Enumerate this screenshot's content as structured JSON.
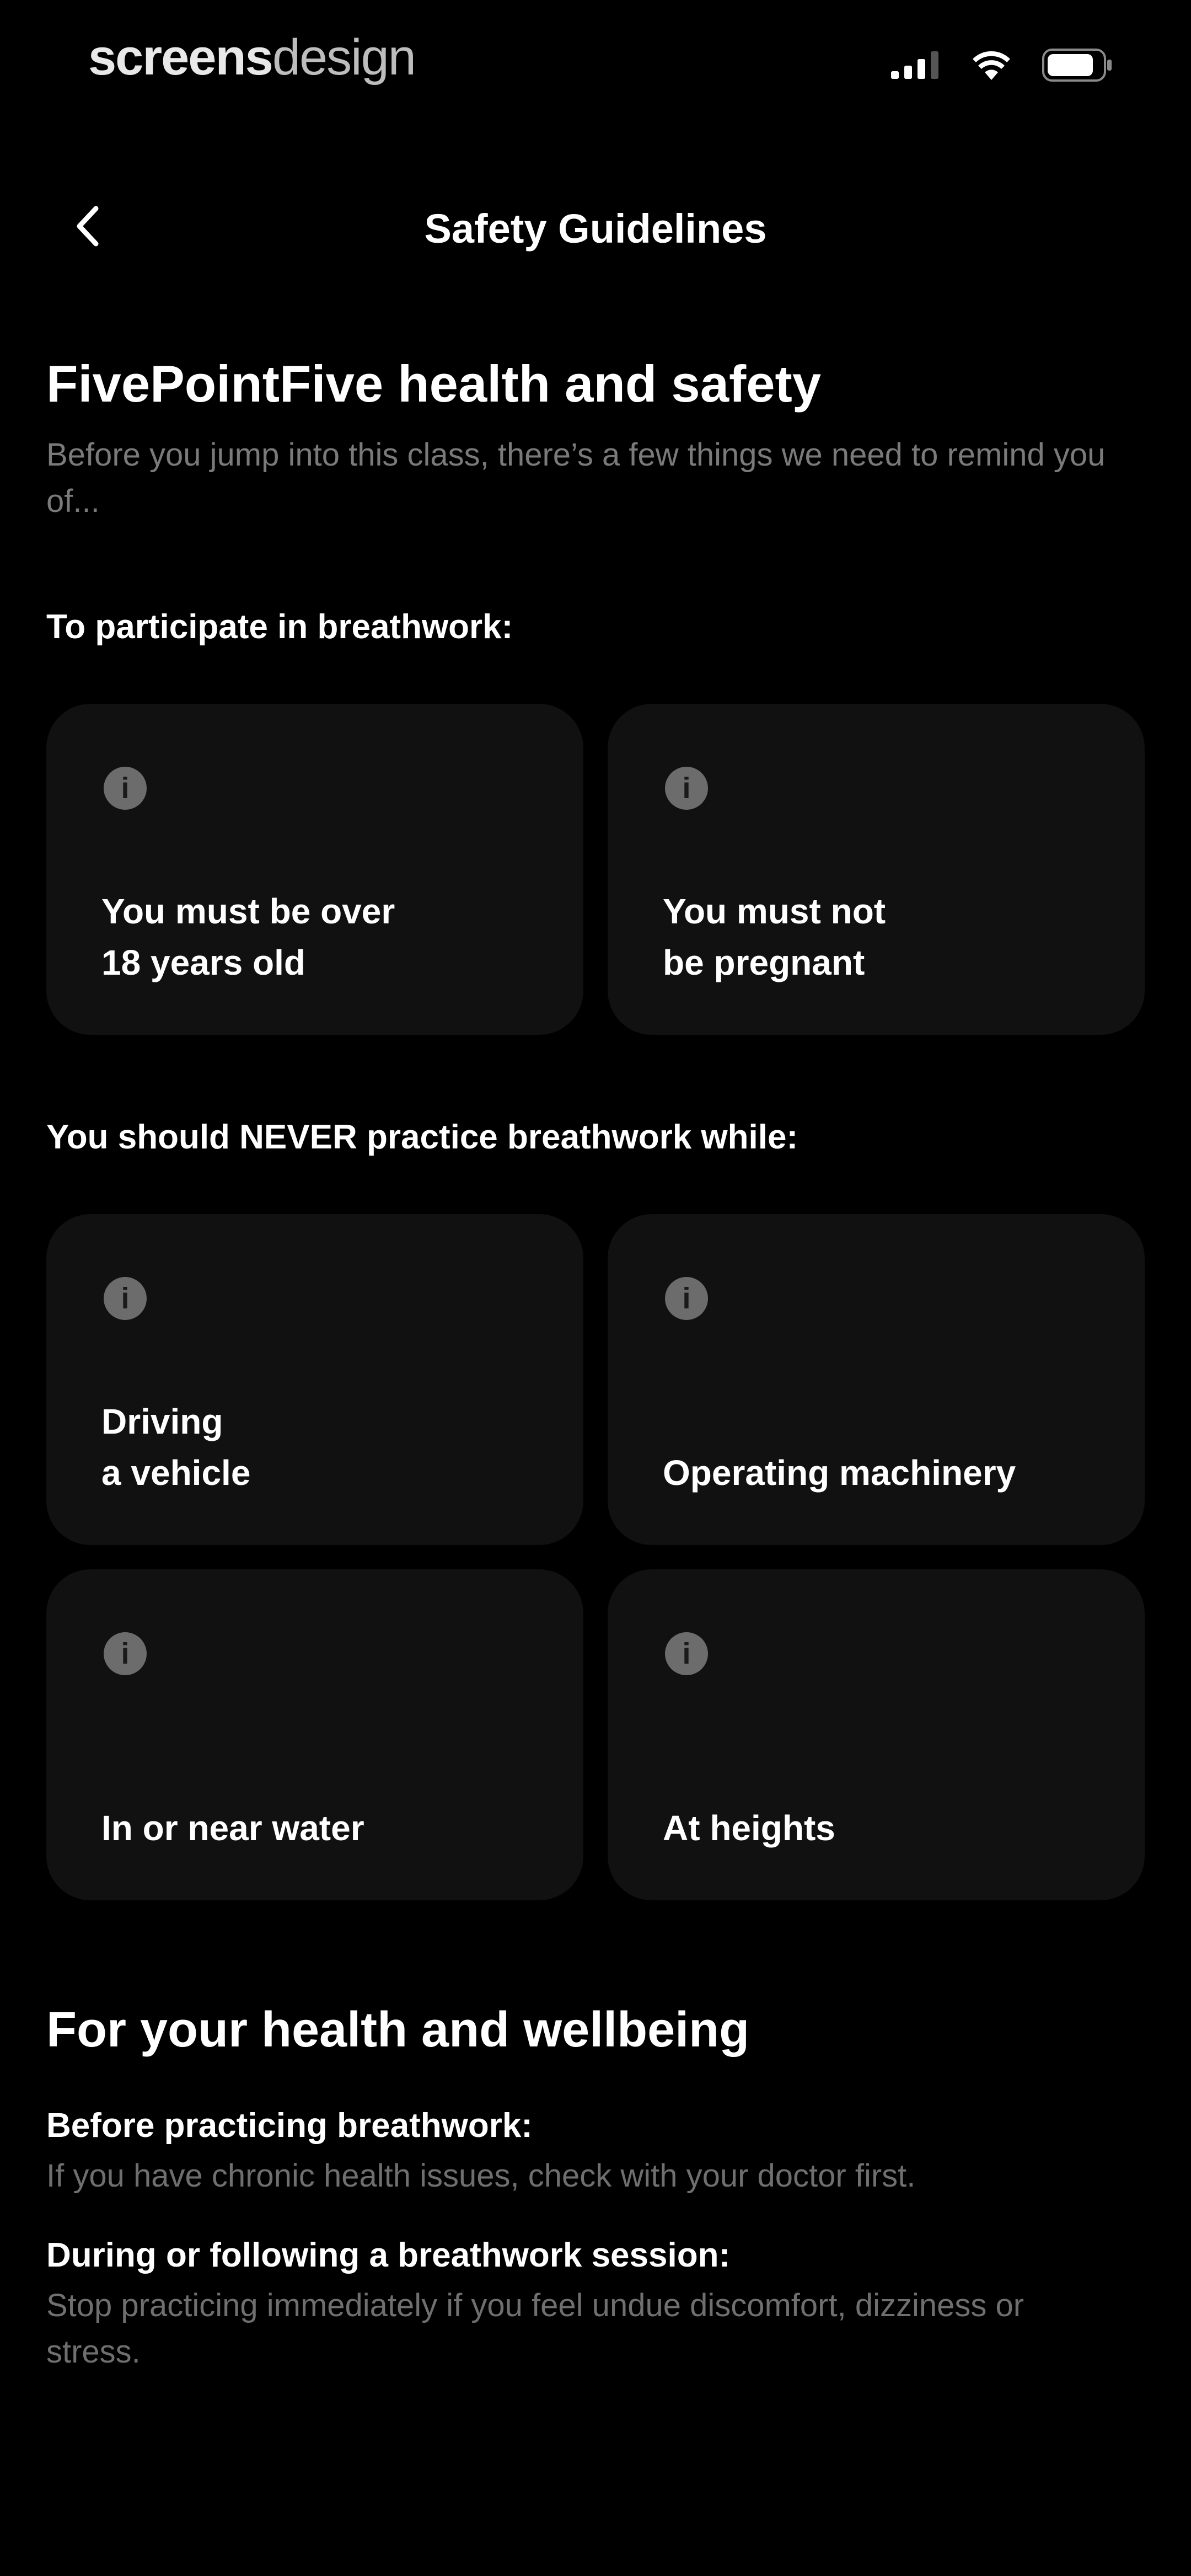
{
  "status_bar": {
    "watermark_bold": "screens",
    "watermark_light": "design",
    "icons": [
      "signal-icon",
      "wifi-icon",
      "battery-icon"
    ]
  },
  "nav": {
    "back_icon": "chevron-left-icon",
    "title": "Safety Guidelines"
  },
  "intro": {
    "title": "FivePointFive health and safety",
    "text": "Before you jump into this class, there’s a few things we need to remind you of..."
  },
  "participate": {
    "label": "To participate in breathwork:",
    "cards": [
      {
        "icon": "info-icon",
        "text": "You must be over\n18 years old"
      },
      {
        "icon": "info-icon",
        "text": "You must not\nbe pregnant"
      }
    ]
  },
  "never": {
    "label": "You should NEVER practice breathwork while:",
    "cards": [
      {
        "icon": "info-icon",
        "text": "Driving\na vehicle"
      },
      {
        "icon": "info-icon",
        "text": "Operating machinery"
      },
      {
        "icon": "info-icon",
        "text": "In or near water"
      },
      {
        "icon": "info-icon",
        "text": "At heights"
      }
    ]
  },
  "wellbeing": {
    "title": "For your health and wellbeing",
    "items": [
      {
        "heading": "Before practicing breathwork:",
        "text": "If you have chronic health issues, check with your doctor first."
      },
      {
        "heading": "During or following a breathwork session:",
        "text": "Stop practicing immediately if you feel undue discomfort, dizziness or stress."
      }
    ]
  },
  "colors": {
    "background": "#000000",
    "card": "#111111",
    "muted_text": "#7a7a7a",
    "icon": "#6c6c6c"
  }
}
